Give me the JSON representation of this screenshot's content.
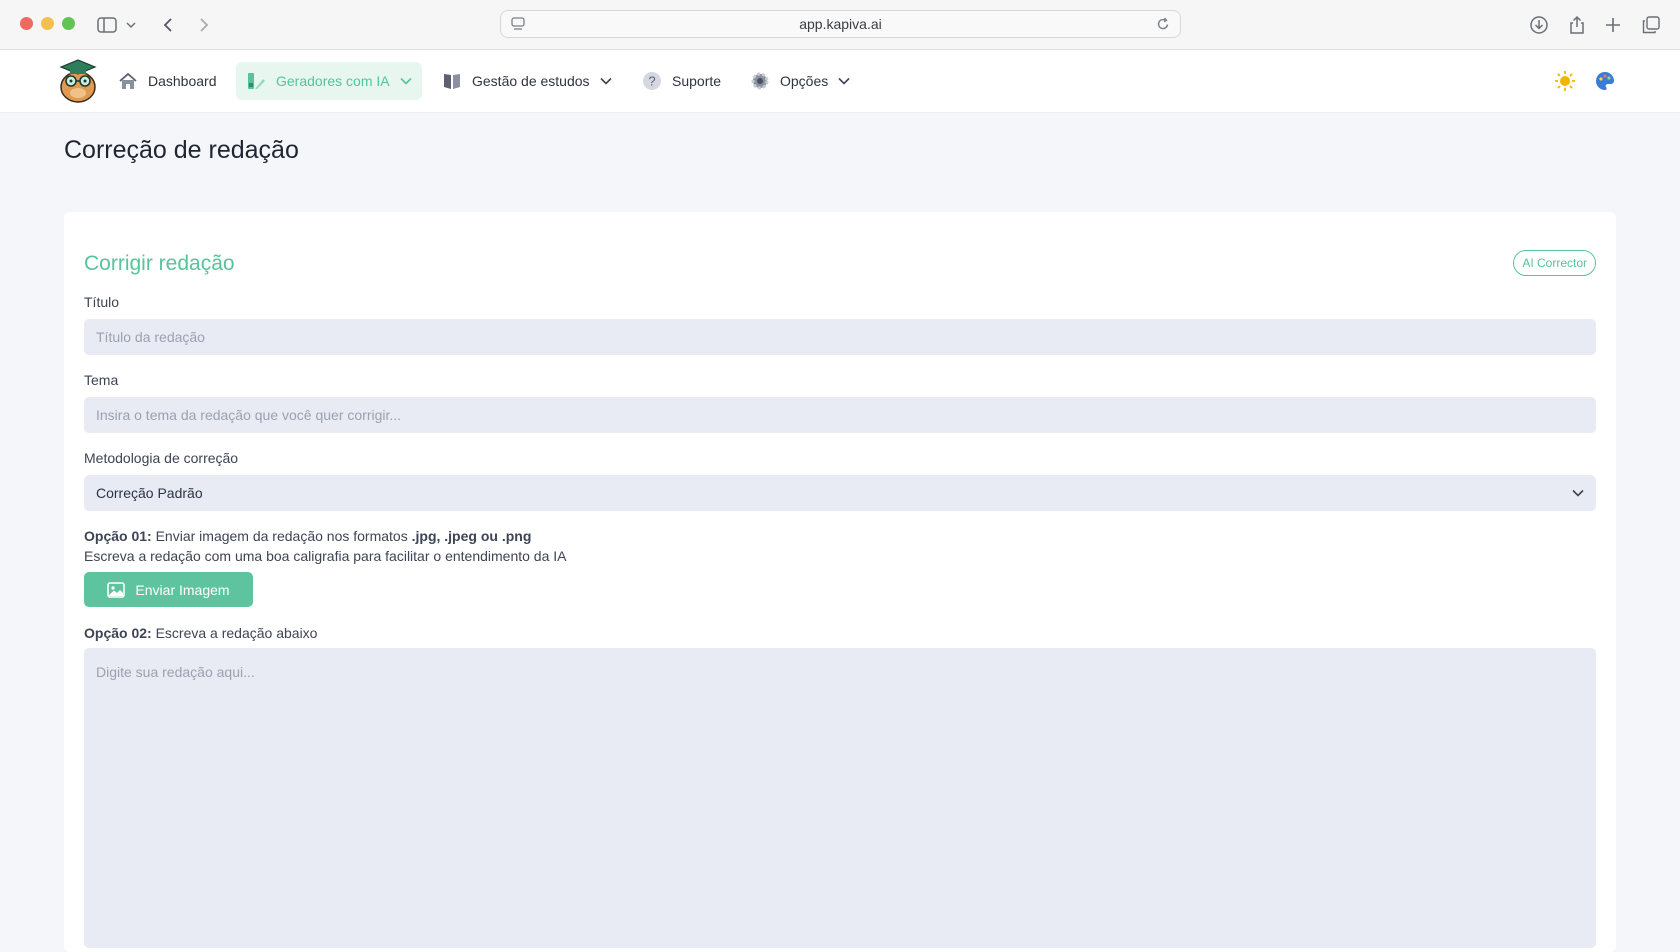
{
  "browser": {
    "url": "app.kapiva.ai"
  },
  "nav": {
    "items": [
      {
        "label": "Dashboard",
        "icon": "home-icon"
      },
      {
        "label": "Geradores com IA",
        "icon": "ai-generator-icon",
        "active": true
      },
      {
        "label": "Gestão de estudos",
        "icon": "book-icon"
      },
      {
        "label": "Suporte",
        "icon": "help-icon"
      },
      {
        "label": "Opções",
        "icon": "gear-icon"
      }
    ],
    "right_icons": [
      "sun-icon",
      "palette-icon"
    ]
  },
  "page": {
    "title": "Correção de redação"
  },
  "form": {
    "card_title": "Corrigir redação",
    "badge": "AI Corrector",
    "titulo_label": "Título",
    "titulo_placeholder": "Título da redação",
    "tema_label": "Tema",
    "tema_placeholder": "Insira o tema da redação que você quer corrigir...",
    "metodologia_label": "Metodologia de correção",
    "metodologia_value": "Correção Padrão",
    "option1_prefix": "Opção 01:",
    "option1_text": "Enviar imagem da redação nos formatos",
    "option1_formats": ".jpg, .jpeg ou .png",
    "option1_hint": "Escreva a redação com uma boa caligrafia para facilitar o entendimento da IA",
    "upload_button": "Enviar Imagem",
    "option2_prefix": "Opção 02:",
    "option2_text": "Escreva a redação abaixo",
    "textarea_placeholder": "Digite sua redação aqui..."
  },
  "colors": {
    "accent": "#55c49a",
    "button": "#5ec4a0",
    "field_bg": "#e8ebf3",
    "page_bg": "#f5f6f9"
  }
}
